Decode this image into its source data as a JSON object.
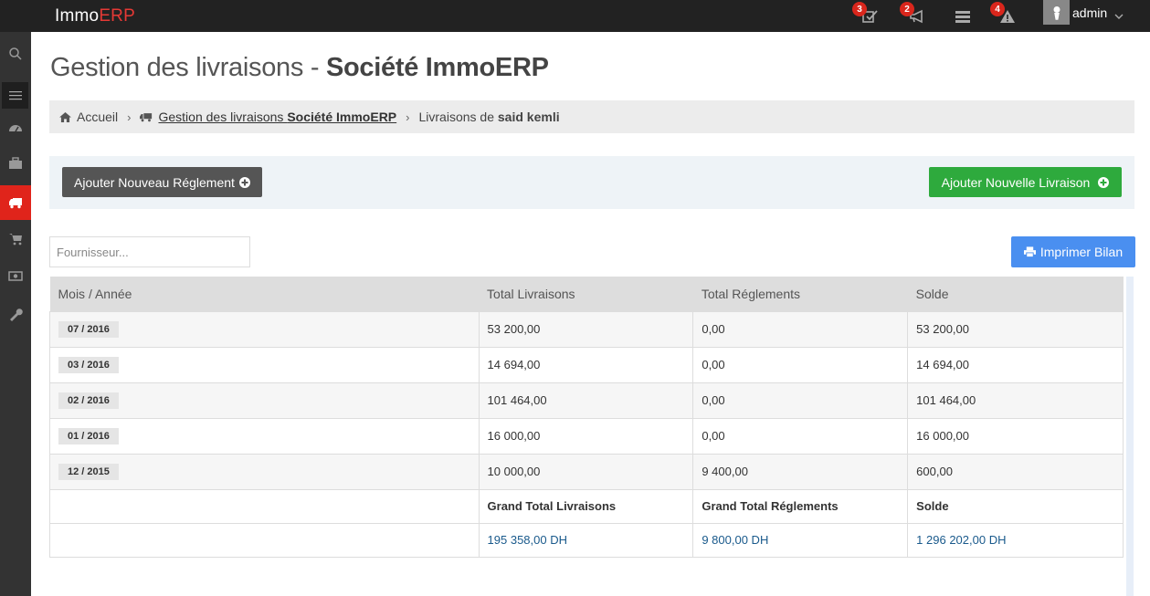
{
  "app": {
    "logo_prefix": "Immo",
    "logo_accent": "ERP"
  },
  "topbar": {
    "badges": {
      "tasks": "3",
      "announcements": "2",
      "messages": "",
      "alerts": "4"
    },
    "user": "admin"
  },
  "page": {
    "title_prefix": "Gestion des livraisons - ",
    "title_bold": "Société ImmoERP"
  },
  "breadcrumb": {
    "home": "Accueil",
    "section_prefix": "Gestion des livraisons ",
    "section_bold": "Société ImmoERP",
    "current_prefix": "Livraisons de ",
    "current_bold": "said kemli"
  },
  "actions": {
    "add_payment": "Ajouter Nouveau Réglement",
    "add_delivery": "Ajouter Nouvelle Livraison",
    "print": "Imprimer Bilan"
  },
  "filter": {
    "placeholder": "Fournisseur..."
  },
  "table": {
    "headers": [
      "Mois / Année",
      "Total Livraisons",
      "Total Réglements",
      "Solde"
    ],
    "rows": [
      {
        "period": "07 / 2016",
        "livraisons": "53 200,00",
        "reglements": "0,00",
        "solde": "53 200,00"
      },
      {
        "period": "03 / 2016",
        "livraisons": "14 694,00",
        "reglements": "0,00",
        "solde": "14 694,00"
      },
      {
        "period": "02 / 2016",
        "livraisons": "101 464,00",
        "reglements": "0,00",
        "solde": "101 464,00"
      },
      {
        "period": "01 / 2016",
        "livraisons": "16 000,00",
        "reglements": "0,00",
        "solde": "16 000,00"
      },
      {
        "period": "12 / 2015",
        "livraisons": "10 000,00",
        "reglements": "9 400,00",
        "solde": "600,00"
      }
    ],
    "totals_headers": [
      "Grand Total Livraisons",
      "Grand Total Réglements",
      "Solde"
    ],
    "totals": [
      "195 358,00 DH",
      "9 800,00 DH",
      "1 296 202,00 DH"
    ]
  },
  "colors": {
    "accent": "#e0241b",
    "green": "#2eaa3d",
    "blue": "#4a8ff0",
    "total_text": "#1a5a8c"
  }
}
